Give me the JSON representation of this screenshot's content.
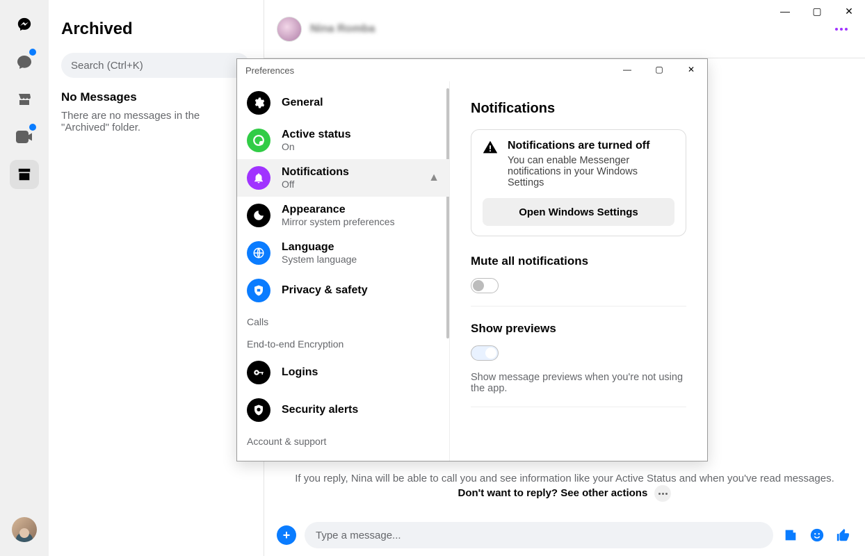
{
  "window_controls": {
    "minimize": "—",
    "maximize": "▢",
    "close": "✕"
  },
  "rail": {
    "items": [
      "messenger-logo",
      "chats",
      "marketplace",
      "video-chats",
      "archived"
    ]
  },
  "archived": {
    "title": "Archived",
    "search_placeholder": "Search (Ctrl+K)",
    "no_messages_title": "No Messages",
    "no_messages_sub": "There are no messages in the \"Archived\" folder."
  },
  "chat": {
    "contact_name": "Nina Romba",
    "info_line": "If you reply, Nina will be able to call you and see information like your Active Status and when you've read messages.",
    "dont_reply": "Don't want to reply? See other actions",
    "composer_placeholder": "Type a message..."
  },
  "prefs": {
    "title": "Preferences",
    "sidebar": [
      {
        "icon": "gear",
        "icon_bg": "#000000",
        "title": "General",
        "sub": ""
      },
      {
        "icon": "status",
        "icon_bg": "#31cc46",
        "title": "Active status",
        "sub": "On"
      },
      {
        "icon": "bell",
        "icon_bg": "#a033ff",
        "title": "Notifications",
        "sub": "Off",
        "active": true,
        "warn": true
      },
      {
        "icon": "moon",
        "icon_bg": "#000000",
        "title": "Appearance",
        "sub": "Mirror system preferences"
      },
      {
        "icon": "globe",
        "icon_bg": "#0a7cff",
        "title": "Language",
        "sub": "System language"
      },
      {
        "icon": "shield",
        "icon_bg": "#0a7cff",
        "title": "Privacy & safety",
        "sub": ""
      }
    ],
    "section_calls": "Calls",
    "section_e2e": "End-to-end Encryption",
    "logins": {
      "icon": "key",
      "icon_bg": "#000000",
      "title": "Logins"
    },
    "security": {
      "icon": "shield2",
      "icon_bg": "#000000",
      "title": "Security alerts"
    },
    "section_account": "Account & support",
    "main": {
      "heading": "Notifications",
      "card_title": "Notifications are turned off",
      "card_sub": "You can enable Messenger notifications in your Windows Settings",
      "card_button": "Open Windows Settings",
      "mute_title": "Mute all notifications",
      "mute_on": false,
      "previews_title": "Show previews",
      "previews_on": true,
      "previews_desc": "Show message previews when you're not using the app."
    }
  }
}
